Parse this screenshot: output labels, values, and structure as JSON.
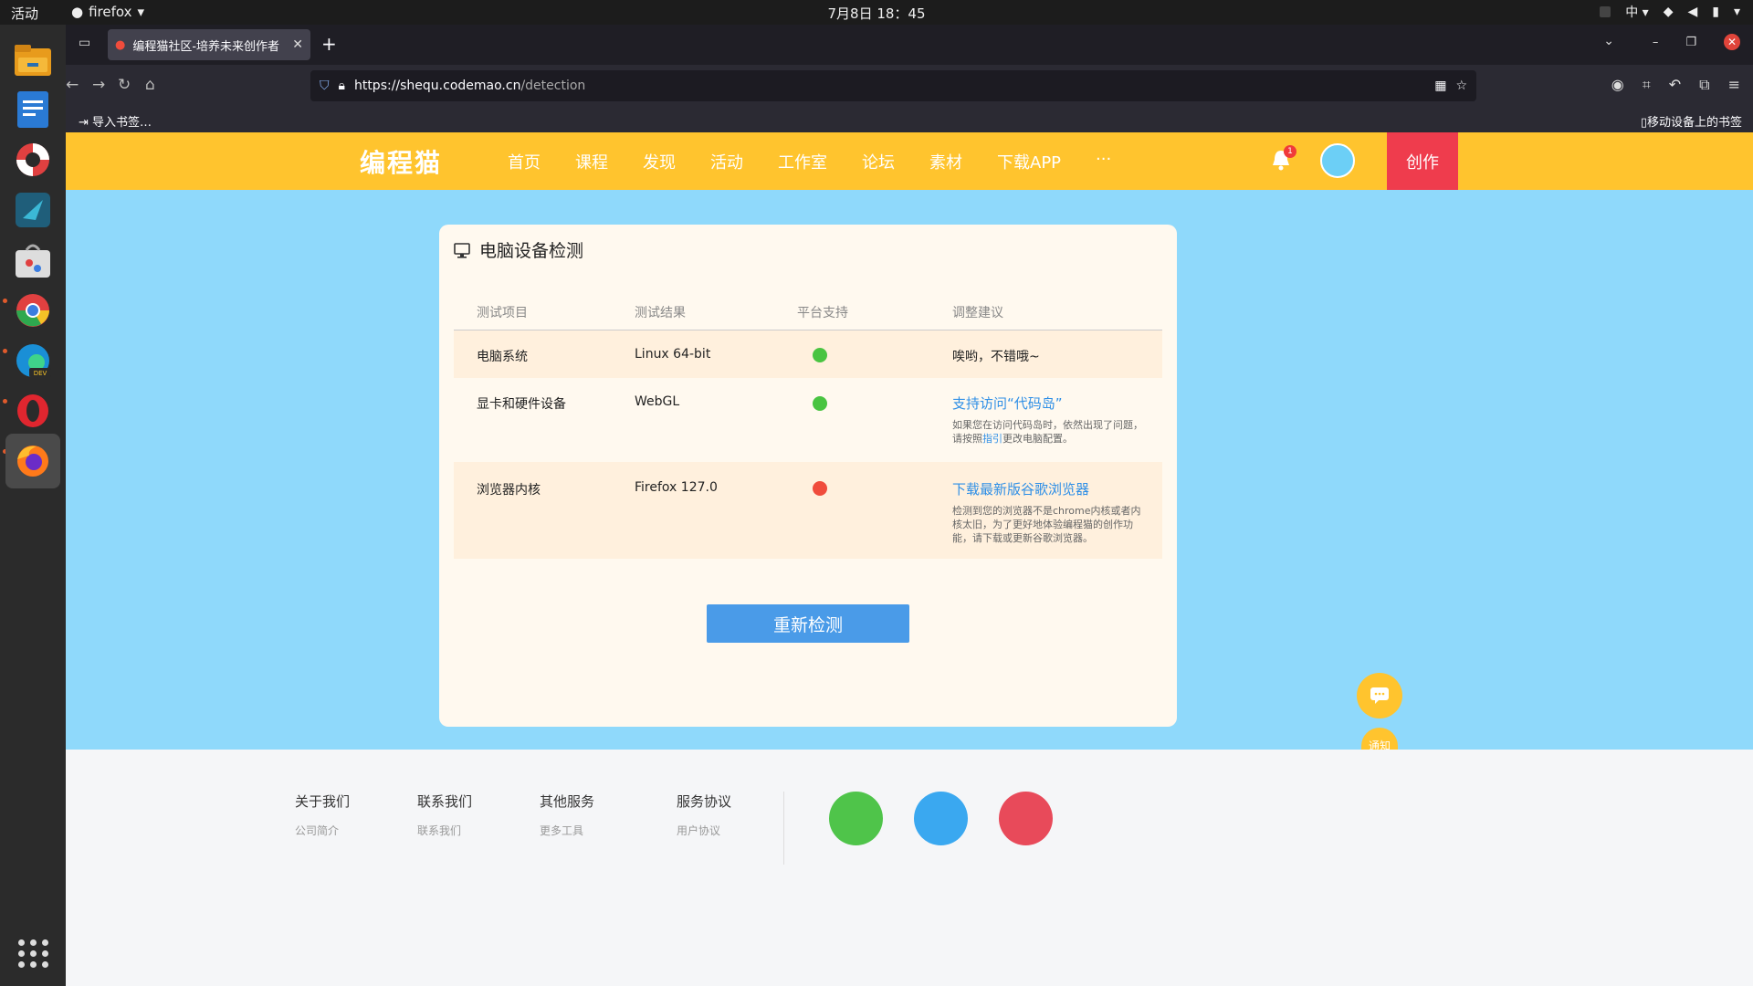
{
  "system": {
    "activities": "活动",
    "app_menu": "firefox",
    "clock": "7月8日  18：45",
    "input_method": "中"
  },
  "browser": {
    "tab_title": "编程猫社区-培养未来创作者",
    "url_host": "https://shequ.codemao.cn",
    "url_path": "/detection",
    "bookmark_import": "导入书签…",
    "mobile_bookmarks": "移动设备上的书签"
  },
  "site": {
    "logo": "编程猫",
    "nav": [
      "首页",
      "课程",
      "发现",
      "活动",
      "工作室",
      "论坛",
      "素材",
      "下载APP",
      "···"
    ],
    "notification_count": "1",
    "create_label": "创作",
    "accent_color": "#ffc42e",
    "create_color": "#ef3c4d"
  },
  "detection": {
    "title": "电脑设备检测",
    "headers": [
      "测试项目",
      "测试结果",
      "平台支持",
      "调整建议"
    ],
    "rows": [
      {
        "item": "电脑系统",
        "result": "Linux 64-bit",
        "status": "good",
        "advice": "唉哟，不错哦~"
      },
      {
        "item": "显卡和硬件设备",
        "result": "WebGL",
        "status": "good",
        "advice_link": "支持访问“代码岛”",
        "note_a": "如果您在访问代码岛时，依然出现了问题，请按照",
        "note_link": "指引",
        "note_b": "更改电脑配置。"
      },
      {
        "item": "浏览器内核",
        "result": "Firefox 127.0",
        "status": "bad",
        "advice_link": "下载最新版谷歌浏览器",
        "note": "检测到您的浏览器不是chrome内核或者内核太旧，为了更好地体验编程猫的创作功能，请下载或更新谷歌浏览器。"
      }
    ],
    "recheck_label": "重新检测"
  },
  "footer": {
    "headings": [
      "关于我们",
      "联系我们",
      "其他服务",
      "服务协议"
    ],
    "links": [
      "公司简介",
      "联系我们",
      "更多工具",
      "用户协议"
    ]
  },
  "floating": {
    "notice_label": "通知"
  }
}
